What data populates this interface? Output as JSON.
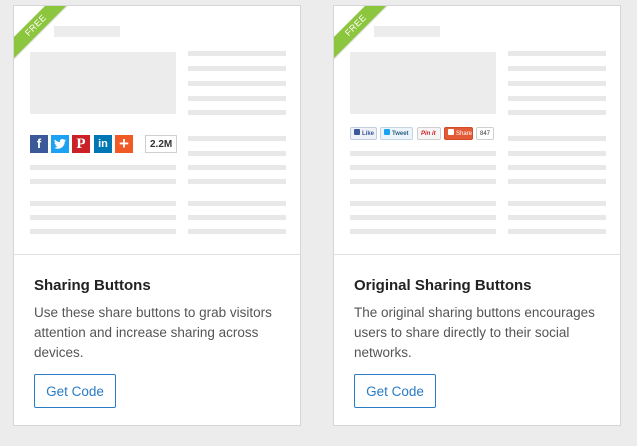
{
  "cards": [
    {
      "ribbon": "FREE",
      "title": "Sharing Buttons",
      "description": "Use these share buttons to grab visitors attention and increase sharing across devices.",
      "button": "Get Code",
      "share_count": "2.2M",
      "icons": [
        "facebook-icon",
        "twitter-icon",
        "pinterest-icon",
        "linkedin-icon",
        "plus-icon"
      ],
      "colors": {
        "facebook": "#3b5998",
        "twitter": "#1da1f2",
        "pinterest": "#cb2027",
        "linkedin": "#0077b5",
        "plus": "#f15a24"
      }
    },
    {
      "ribbon": "FREE",
      "title": "Original Sharing Buttons",
      "description": "The original sharing buttons encourages users to share directly to their social networks.",
      "button": "Get Code",
      "original_buttons": [
        "Like",
        "Tweet",
        "Pin it",
        "Share",
        "847"
      ]
    }
  ],
  "colors": {
    "ribbon": "#8cc63f",
    "accent": "#2a7cc7"
  }
}
